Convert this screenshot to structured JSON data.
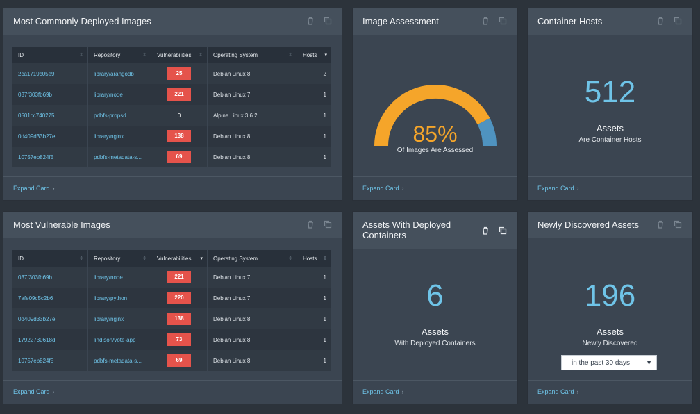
{
  "common_images": {
    "title": "Most Commonly Deployed Images",
    "headers": [
      "ID",
      "Repository",
      "Vulnerabilities",
      "Operating System",
      "Hosts"
    ],
    "rows": [
      {
        "id": "2ca1719c05e9",
        "repo": "library/arangodb",
        "vulns": "25",
        "os": "Debian Linux 8",
        "hosts": "2"
      },
      {
        "id": "037f303fb69b",
        "repo": "library/node",
        "vulns": "221",
        "os": "Debian Linux 7",
        "hosts": "1"
      },
      {
        "id": "0501cc740275",
        "repo": "pdbfs-propsd",
        "vulns": "0",
        "os": "Alpine Linux 3.6.2",
        "hosts": "1"
      },
      {
        "id": "0d409d33b27e",
        "repo": "library/nginx",
        "vulns": "138",
        "os": "Debian Linux 8",
        "hosts": "1"
      },
      {
        "id": "10757eb824f5",
        "repo": "pdbfs-metadata-s...",
        "vulns": "69",
        "os": "Debian Linux 8",
        "hosts": "1"
      }
    ],
    "expand": "Expand Card"
  },
  "vulnerable_images": {
    "title": "Most Vulnerable Images",
    "headers": [
      "ID",
      "Repository",
      "Vulnerabilities",
      "Operating System",
      "Hosts"
    ],
    "rows": [
      {
        "id": "037f303fb69b",
        "repo": "library/node",
        "vulns": "221",
        "os": "Debian Linux 7",
        "hosts": "1"
      },
      {
        "id": "7afe09c5c2b6",
        "repo": "library/python",
        "vulns": "220",
        "os": "Debian Linux 7",
        "hosts": "1"
      },
      {
        "id": "0d409d33b27e",
        "repo": "library/nginx",
        "vulns": "138",
        "os": "Debian Linux 8",
        "hosts": "1"
      },
      {
        "id": "17922730618d",
        "repo": "lindison/vote-app",
        "vulns": "73",
        "os": "Debian Linux 8",
        "hosts": "1"
      },
      {
        "id": "10757eb824f5",
        "repo": "pdbfs-metadata-s...",
        "vulns": "69",
        "os": "Debian Linux 8",
        "hosts": "1"
      }
    ],
    "expand": "Expand Card"
  },
  "image_assessment": {
    "title": "Image Assessment",
    "percent_label": "85%",
    "percent_value": 0.85,
    "subtitle": "Of Images Are Assessed",
    "colors": {
      "assessed": "#f5a52a",
      "remaining": "#4f93c0"
    },
    "expand": "Expand Card"
  },
  "container_hosts": {
    "title": "Container Hosts",
    "value": "512",
    "label": "Assets",
    "sub": "Are Container Hosts",
    "expand": "Expand Card"
  },
  "deployed_containers": {
    "title": "Assets With Deployed Containers",
    "value": "6",
    "label": "Assets",
    "sub": "With Deployed Containers",
    "expand": "Expand Card"
  },
  "newly_discovered": {
    "title": "Newly Discovered Assets",
    "value": "196",
    "label": "Assets",
    "sub": "Newly Discovered",
    "range_selected": "in the past 30 days",
    "expand": "Expand Card"
  },
  "icons": {
    "delete": "trash-icon",
    "copy": "copy-icon",
    "chevron": "chevron-right-icon",
    "sort": "sort-icon"
  },
  "theme": {
    "background": "#2c333b",
    "card": "#3b4551",
    "accent": "#6fc4e8",
    "danger": "#e5534b"
  }
}
